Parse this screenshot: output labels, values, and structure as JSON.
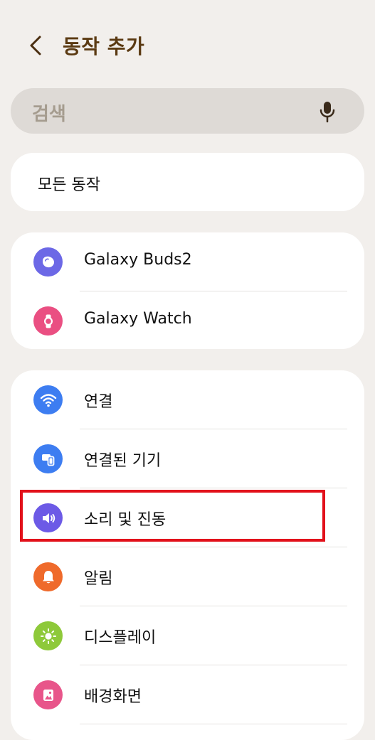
{
  "header": {
    "title": "동작 추가"
  },
  "search": {
    "placeholder": "검색"
  },
  "all_actions": {
    "label": "모든 동작"
  },
  "devices": [
    {
      "label": "Galaxy Buds2",
      "icon": "earbuds-icon",
      "color": "#6c68e6"
    },
    {
      "label": "Galaxy Watch",
      "icon": "watch-icon",
      "color": "#ea4f82"
    }
  ],
  "settings": [
    {
      "label": "연결",
      "icon": "wifi-icon",
      "color": "#3d7df1"
    },
    {
      "label": "연결된 기기",
      "icon": "connected-devices-icon",
      "color": "#3d7df1"
    },
    {
      "label": "소리 및 진동",
      "icon": "speaker-icon",
      "color": "#6c5ae6"
    },
    {
      "label": "알림",
      "icon": "bell-icon",
      "color": "#ef6a2b"
    },
    {
      "label": "디스플레이",
      "icon": "sun-icon",
      "color": "#8ec93a"
    },
    {
      "label": "배경화면",
      "icon": "wallpaper-icon",
      "color": "#e8558a"
    }
  ]
}
